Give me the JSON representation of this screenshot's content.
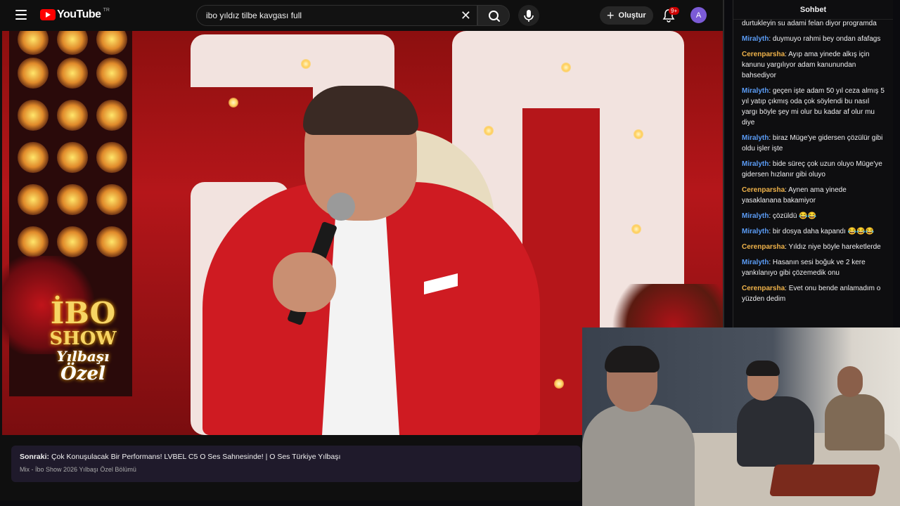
{
  "youtube": {
    "logo_text": "YouTube",
    "region": "TR",
    "search_query": "ibo yıldız tilbe kavgası full",
    "create_label": "Oluştur",
    "notification_count": "9+",
    "avatar_letter": "A"
  },
  "video": {
    "show_lines": [
      "İBO",
      "SHOW",
      "Yılbaşı",
      "Özel"
    ]
  },
  "up_next": {
    "prefix": "Sonraki:",
    "title": "Çok Konuşulacak Bir Performans! LVBEL C5 O Ses Sahnesinde! | O Ses Türkiye Yılbaşı",
    "subtitle": "Mix - İbo Show 2026 Yılbaşı Özel Bölümü"
  },
  "chat": {
    "title": "Sohbet",
    "messages": [
      {
        "user": "",
        "text": "durtukleyin su adami felan diyor programda",
        "color": "#efeff1"
      },
      {
        "user": "Miralyth",
        "text": "duymuyo rahmi bey ondan afafags",
        "color": "#5b9cf5"
      },
      {
        "user": "Cerenparsha",
        "text": "Ayıp ama yinede alkış için kanunu yargılıyor adam kanunundan bahsediyor",
        "color": "#f0b34a"
      },
      {
        "user": "Miralyth",
        "text": "geçen işte adam 50 yıl ceza almış 5 yıl yatıp çıkmış oda çok söylendi bu nasıl yargı böyle şey mi olur bu kadar af olur mu diye",
        "color": "#5b9cf5"
      },
      {
        "user": "Miralyth",
        "text": "biraz Müge'ye gidersen çözülür gibi oldu işler işte",
        "color": "#5b9cf5"
      },
      {
        "user": "Miralyth",
        "text": "bide süreç çok uzun oluyo Müge'ye gidersen hızlanır gibi oluyo",
        "color": "#5b9cf5"
      },
      {
        "user": "Cerenparsha",
        "text": "Aynen ama yinede yasaklanana bakamiyor",
        "color": "#f0b34a"
      },
      {
        "user": "Miralyth",
        "text": "çözüldü 😂😂",
        "color": "#5b9cf5"
      },
      {
        "user": "Miralyth",
        "text": "bir dosya daha kapandı 😂😂😂",
        "color": "#5b9cf5"
      },
      {
        "user": "Cerenparsha",
        "text": "Yıldız niye böyle hareketlerde",
        "color": "#f0b34a"
      },
      {
        "user": "Miralyth",
        "text": "Hasanın sesi boğuk ve 2 kere yankılanıyo gibi çözemedik onu",
        "color": "#5b9cf5"
      },
      {
        "user": "Cerenparsha",
        "text": "Evet onu bende anlamadım o yüzden dedim",
        "color": "#f0b34a"
      }
    ]
  }
}
